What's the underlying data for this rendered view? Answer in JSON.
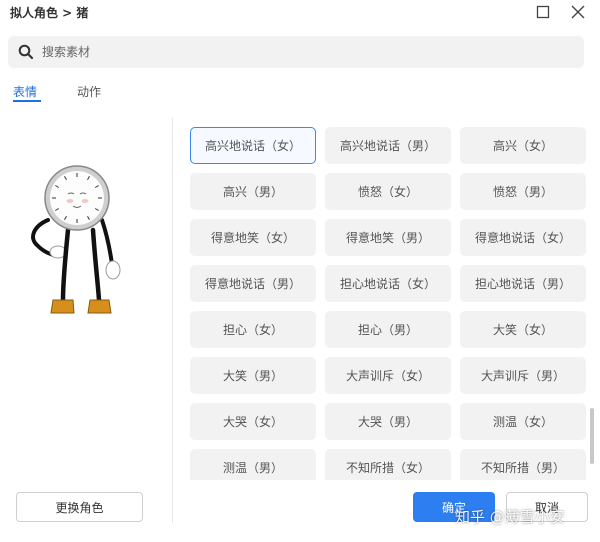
{
  "header": {
    "title": "拟人角色 > 猪"
  },
  "search": {
    "placeholder": "搜索素材"
  },
  "tabs": [
    {
      "label": "表情",
      "active": true
    },
    {
      "label": "动作",
      "active": false
    }
  ],
  "expressions": [
    "高兴地说话（女）",
    "高兴地说话（男）",
    "高兴（女）",
    "高兴（男）",
    "愤怒（女）",
    "愤怒（男）",
    "得意地笑（女）",
    "得意地笑（男）",
    "得意地说话（女）",
    "得意地说话（男）",
    "担心地说话（女）",
    "担心地说话（男）",
    "担心（女）",
    "担心（男）",
    "大笑（女）",
    "大笑（男）",
    "大声训斥（女）",
    "大声训斥（男）",
    "大哭（女）",
    "大哭（男）",
    "测温（女）",
    "测温（男）",
    "不知所措（女）",
    "不知所措（男）"
  ],
  "selected_index": 0,
  "footer": {
    "change_role_label": "更换角色",
    "confirm_label": "确定",
    "cancel_label": "取消"
  },
  "watermark": "知乎 @薄雪小安",
  "colors": {
    "accent": "#2d7ef0",
    "cell_bg": "#f2f2f2"
  }
}
